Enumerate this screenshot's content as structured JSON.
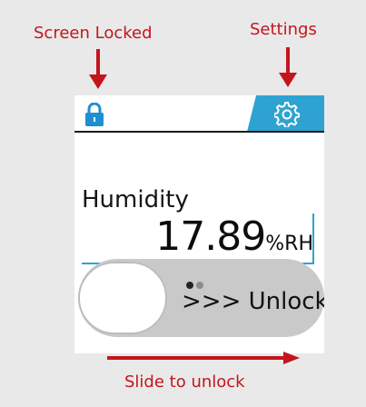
{
  "annotations": {
    "screen_locked": "Screen Locked",
    "settings": "Settings",
    "slide_to_unlock": "Slide to unlock"
  },
  "device": {
    "humidity_label": "Humidity",
    "humidity_value": "17.89",
    "humidity_unit": "%RH",
    "slider_text": ">>> Unlock"
  },
  "colors": {
    "annotation_red": "#c3161c",
    "accent_blue": "#2ea3d1",
    "slider_gray": "#c9c9c9"
  },
  "icons": [
    "lock-icon",
    "gear-icon",
    "arrow-down-icon",
    "arrow-right-icon"
  ]
}
